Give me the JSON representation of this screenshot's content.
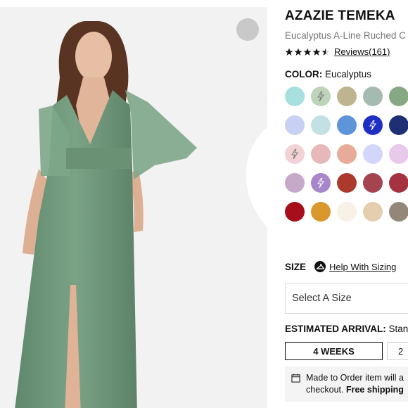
{
  "product": {
    "brand": "AZAZIE TEMEKA",
    "subtitle": "Eucalyptus A-Line Ruched C",
    "rating_stars": 4.5,
    "reviews_label": "Reviews(161)"
  },
  "color": {
    "label": "COLOR:",
    "selected": "Eucalyptus",
    "swatches": [
      {
        "hex": "#a8e0e0",
        "bolt": false
      },
      {
        "hex": "#bed4b9",
        "bolt": true
      },
      {
        "hex": "#bdb58f",
        "bolt": false
      },
      {
        "hex": "#a5bbb1",
        "bolt": false
      },
      {
        "hex": "#86a882",
        "bolt": false
      },
      {
        "hex": "#c7e9ea",
        "bolt": false
      },
      {
        "hex": "#c8d0f4",
        "bolt": false
      },
      {
        "hex": "#c3e0e4",
        "bolt": false
      },
      {
        "hex": "#5e95d8",
        "bolt": false
      },
      {
        "hex": "#1f2fc4",
        "bolt": true
      },
      {
        "hex": "#1e2f73",
        "bolt": false
      },
      {
        "hex": "#eeddd6",
        "bolt": false
      },
      {
        "hex": "#f2d2d4",
        "bolt": true
      },
      {
        "hex": "#e6b8b9",
        "bolt": false
      },
      {
        "hex": "#e9ab99",
        "bolt": false
      },
      {
        "hex": "#d3d6fb",
        "bolt": false
      },
      {
        "hex": "#e8c9ec",
        "bolt": false
      },
      {
        "hex": "#e7c6fa",
        "bolt": false
      },
      {
        "hex": "#c6a8c8",
        "bolt": false
      },
      {
        "hex": "#a786cc",
        "bolt": true
      },
      {
        "hex": "#ab3a2c",
        "bolt": false
      },
      {
        "hex": "#a54451",
        "bolt": false
      },
      {
        "hex": "#a5323f",
        "bolt": false
      },
      {
        "hex": "#c7141f",
        "bolt": false
      },
      {
        "hex": "#a60e1c",
        "bolt": false
      },
      {
        "hex": "#d9982c",
        "bolt": false
      },
      {
        "hex": "#f7f1e7",
        "bolt": false
      },
      {
        "hex": "#e3cfae",
        "bolt": false
      },
      {
        "hex": "#938779",
        "bolt": false
      },
      {
        "hex": "#ececec",
        "bolt": false
      }
    ]
  },
  "size": {
    "label": "SIZE",
    "help_label": "Help With Sizing",
    "select_placeholder": "Select A Size"
  },
  "arrival": {
    "label": "ESTIMATED ARRIVAL:",
    "value": "Stan",
    "options": [
      "4 WEEKS",
      "2"
    ]
  },
  "notice": {
    "line1": "Made to Order item will a",
    "line2_prefix": "checkout. ",
    "line2_bold": "Free shipping"
  },
  "icons": {
    "favorite": "heart-icon",
    "star": "star-icon",
    "sizing": "hanger-icon",
    "calendar": "calendar-icon",
    "express": "lightning-bolt-icon"
  }
}
